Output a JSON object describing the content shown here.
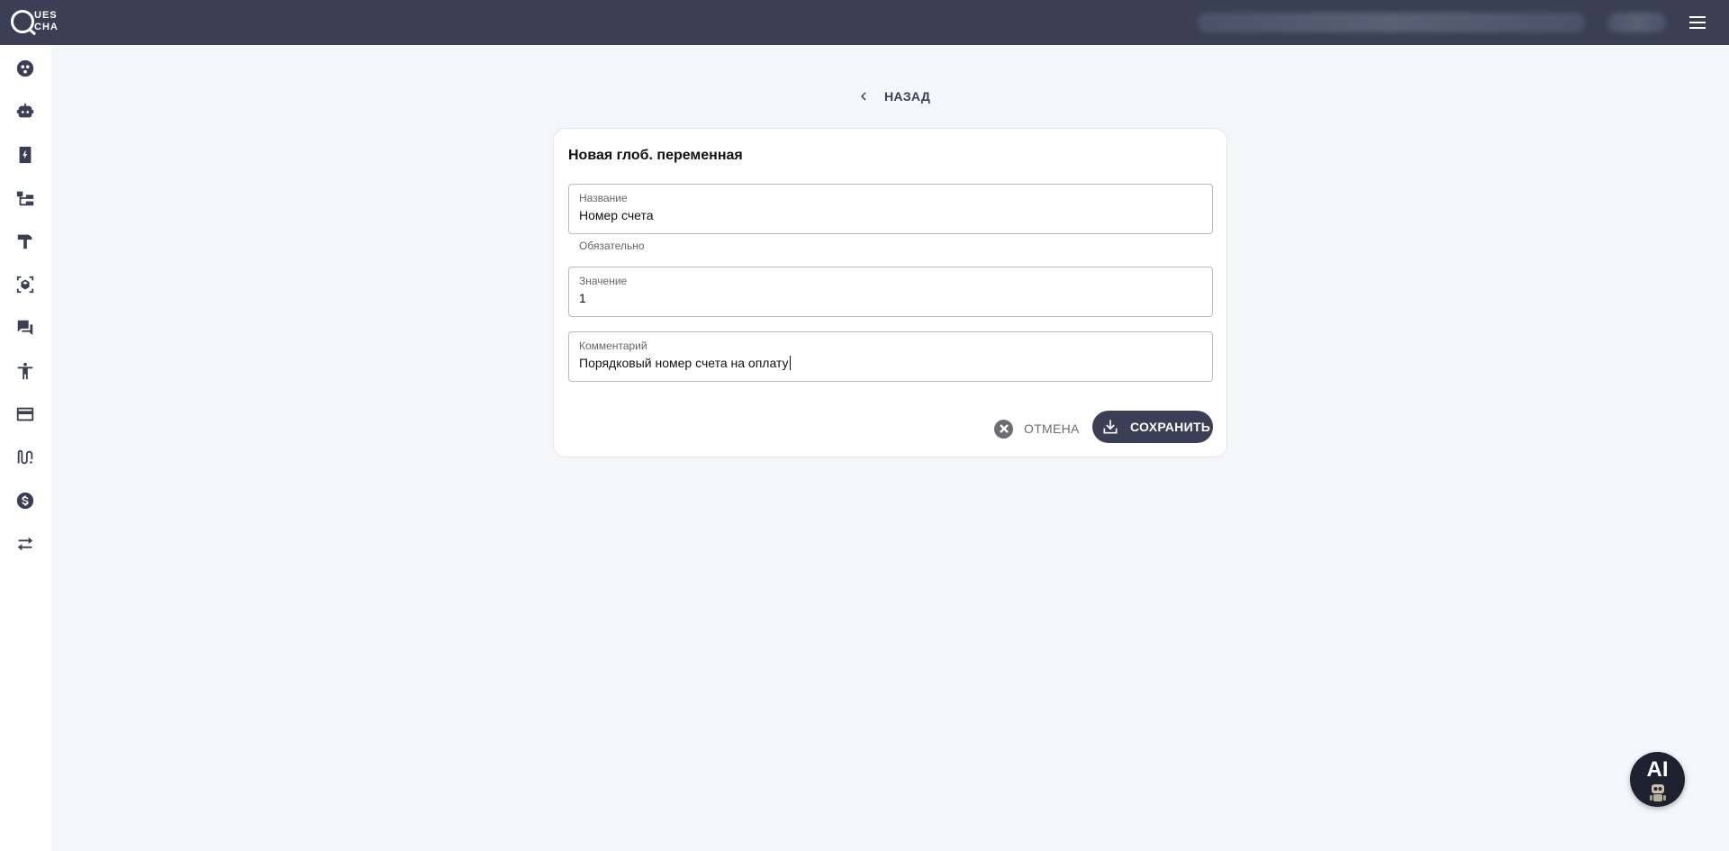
{
  "app": {
    "logo_line1": "UES",
    "logo_line2": "CHA"
  },
  "nav": {
    "back_label": "НАЗАД"
  },
  "form": {
    "title": "Новая глоб. переменная",
    "name_field": {
      "label": "Название",
      "value": "Номер счета",
      "helper": "Обязательно"
    },
    "value_field": {
      "label": "Значение",
      "value": "1"
    },
    "comment_field": {
      "label": "Комментарий",
      "value": "Порядковый номер счета на оплату"
    },
    "cancel_label": "ОТМЕНА",
    "save_label": "СОХРАНИТЬ"
  },
  "ai": {
    "label": "AI"
  },
  "sidebar": {
    "icons": [
      "dashboard-icon",
      "bot-icon",
      "device-icon",
      "tree-icon",
      "hammer-icon",
      "cube-icon",
      "chat-icon",
      "accessibility-icon",
      "card-icon",
      "route-icon",
      "dollar-icon",
      "swap-icon"
    ]
  },
  "colors": {
    "primary": "#3a3f55",
    "background": "#f5f6fa",
    "card": "#ffffff",
    "muted": "#6b6d73"
  }
}
